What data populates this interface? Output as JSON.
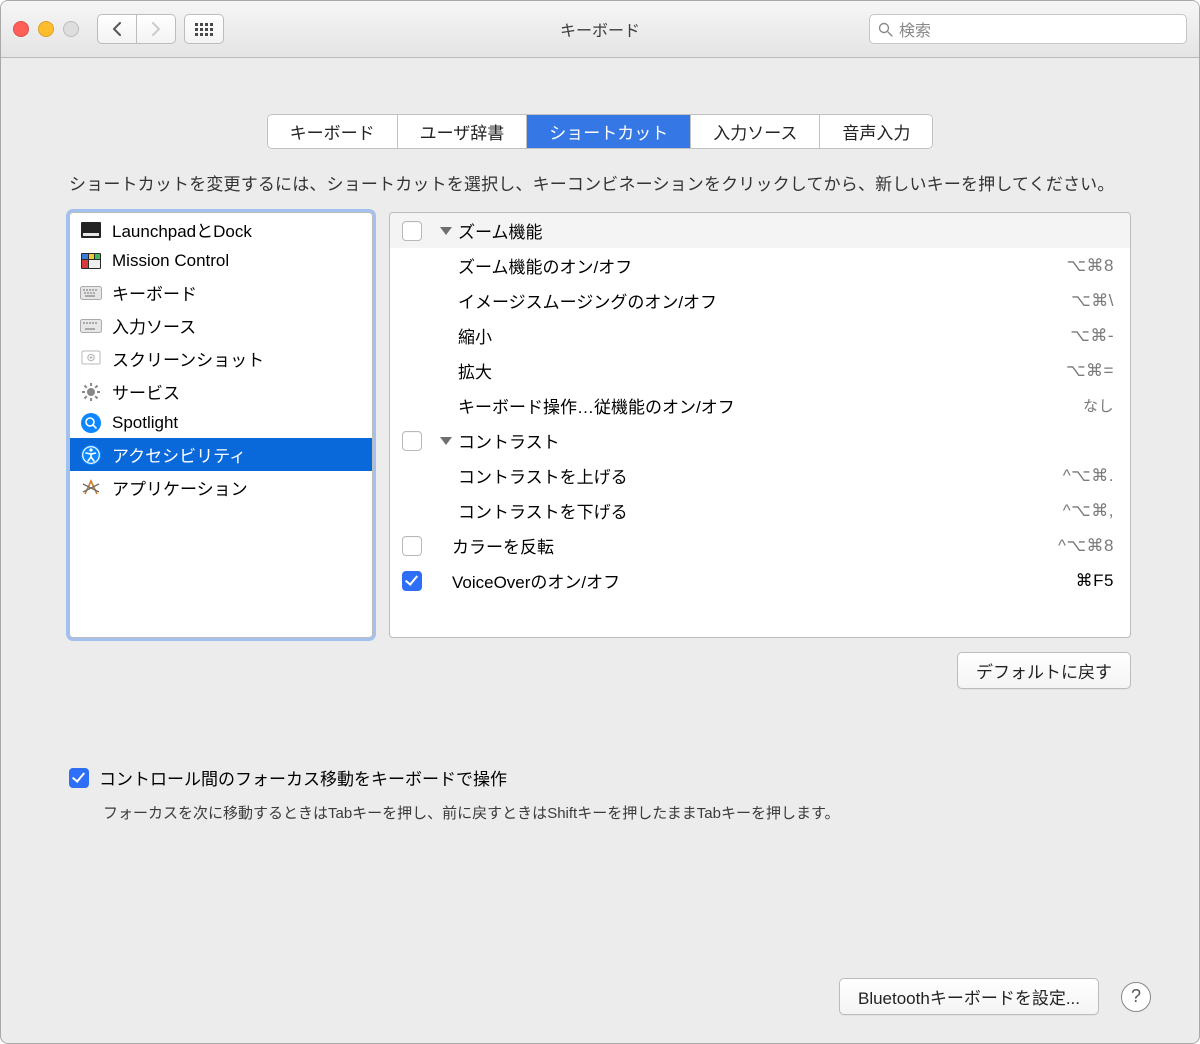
{
  "window": {
    "title": "キーボード"
  },
  "search": {
    "placeholder": "検索"
  },
  "tabs": [
    {
      "label": "キーボード"
    },
    {
      "label": "ユーザ辞書"
    },
    {
      "label": "ショートカット",
      "active": true
    },
    {
      "label": "入力ソース"
    },
    {
      "label": "音声入力"
    }
  ],
  "instruction": "ショートカットを変更するには、ショートカットを選択し、キーコンビネーションをクリックしてから、新しいキーを押してください。",
  "categories": [
    {
      "label": "LaunchpadとDock"
    },
    {
      "label": "Mission Control"
    },
    {
      "label": "キーボード"
    },
    {
      "label": "入力ソース"
    },
    {
      "label": "スクリーンショット"
    },
    {
      "label": "サービス"
    },
    {
      "label": "Spotlight"
    },
    {
      "label": "アクセシビリティ"
    },
    {
      "label": "アプリケーション"
    }
  ],
  "groups": [
    {
      "title": "ズーム機能",
      "checked": false,
      "items": [
        {
          "label": "ズーム機能のオン/オフ",
          "shortcut": "⌥⌘8"
        },
        {
          "label": "イメージスムージングのオン/オフ",
          "shortcut": "⌥⌘\\"
        },
        {
          "label": "縮小",
          "shortcut": "⌥⌘-"
        },
        {
          "label": "拡大",
          "shortcut": "⌥⌘="
        },
        {
          "label": "キーボード操作…従機能のオン/オフ",
          "shortcut": "なし"
        }
      ]
    },
    {
      "title": "コントラスト",
      "checked": false,
      "items": [
        {
          "label": "コントラストを上げる",
          "shortcut": "^⌥⌘."
        },
        {
          "label": "コントラストを下げる",
          "shortcut": "^⌥⌘,"
        }
      ]
    }
  ],
  "rows": [
    {
      "label": "カラーを反転",
      "checked": false,
      "shortcut": "^⌥⌘8",
      "enabled": false
    },
    {
      "label": "VoiceOverのオン/オフ",
      "checked": true,
      "shortcut": "⌘F5",
      "enabled": true
    }
  ],
  "restore_defaults": "デフォルトに戻す",
  "focus": {
    "label": "コントロール間のフォーカス移動をキーボードで操作",
    "hint": "フォーカスを次に移動するときはTabキーを押し、前に戻すときはShiftキーを押したままTabキーを押します。"
  },
  "bluetooth": "Bluetoothキーボードを設定...",
  "help": "?"
}
